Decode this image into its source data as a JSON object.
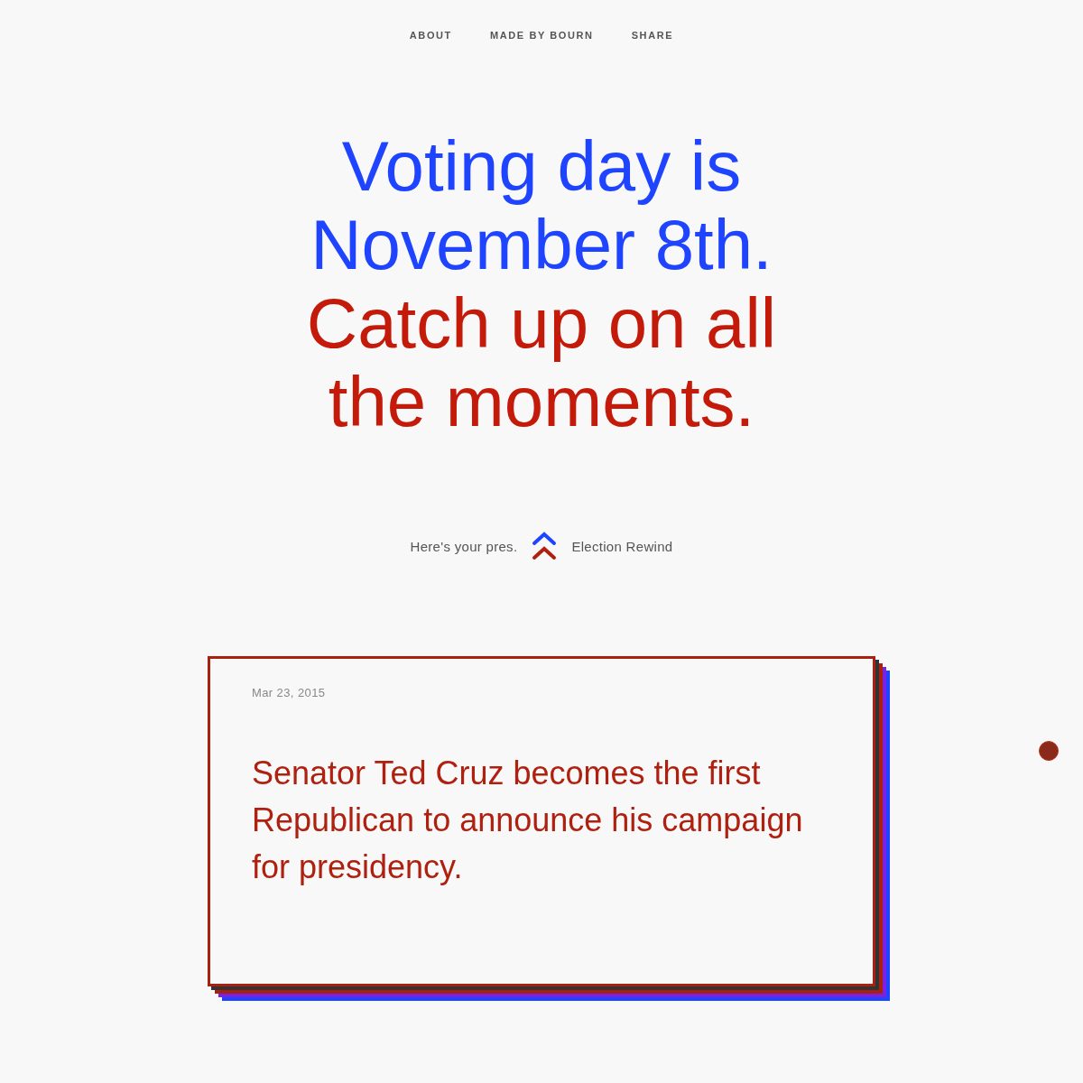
{
  "nav": [
    "ABOUT",
    "MADE BY BOURN",
    "SHARE"
  ],
  "headline": [
    {
      "text": "Voting day is",
      "color": "#1f44ff"
    },
    {
      "text": "November 8th.",
      "color": "#1f44ff"
    },
    {
      "text": "Catch up on all",
      "color": "#c41a0a"
    },
    {
      "text": "the moments.",
      "color": "#c41a0a"
    }
  ],
  "tagline": {
    "left": "Here's your pres.",
    "right": "Election Rewind"
  },
  "card": {
    "date": "Mar 23, 2015",
    "text": "Senator Ted Cruz becomes the first Republican to announce his campaign for presidency."
  }
}
